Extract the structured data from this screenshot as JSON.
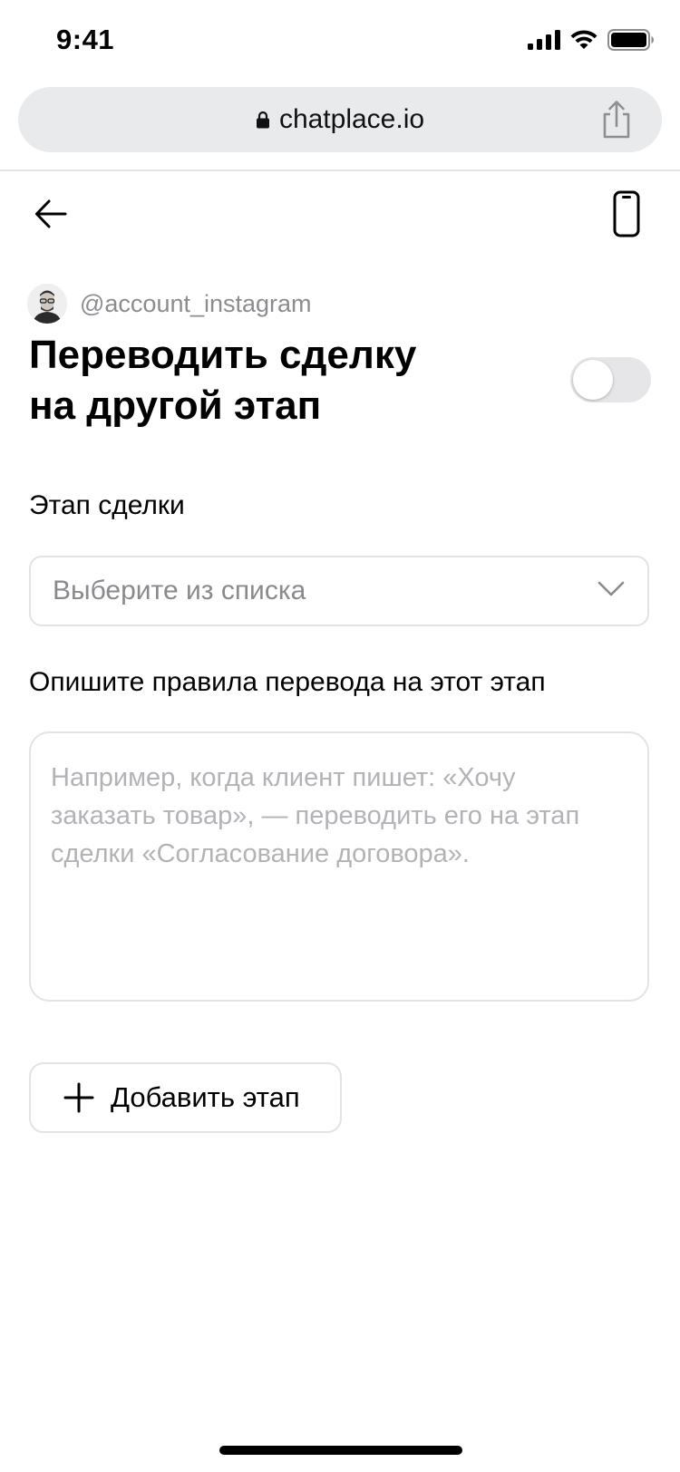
{
  "status_bar": {
    "time": "9:41"
  },
  "browser": {
    "url": "chatplace.io"
  },
  "account": {
    "handle": "@account_instagram"
  },
  "page": {
    "title_line1": "Переводить сделку",
    "title_line2": "на другой этап",
    "toggle_on": false
  },
  "stage_field": {
    "label": "Этап сделки",
    "placeholder": "Выберите из списка"
  },
  "rules_field": {
    "label": "Опишите правила перевода на этот этап",
    "placeholder": "Например, когда клиент пишет: «Хочу заказать товар», — переводить его на этап сделки «Согласование договора»."
  },
  "actions": {
    "add_stage_label": "Добавить этап"
  },
  "colors": {
    "url_bar_bg": "#e9eaec",
    "border": "#e3e3e6",
    "placeholder": "#8a8a8e",
    "muted_text": "#8c8c90",
    "toggle_off": "#e6e6e8"
  },
  "icons": {
    "back": "arrow-left-icon",
    "device": "phone-outline-icon",
    "lock": "lock-icon",
    "share": "share-icon",
    "chevron": "chevron-down-icon",
    "plus": "plus-icon"
  }
}
